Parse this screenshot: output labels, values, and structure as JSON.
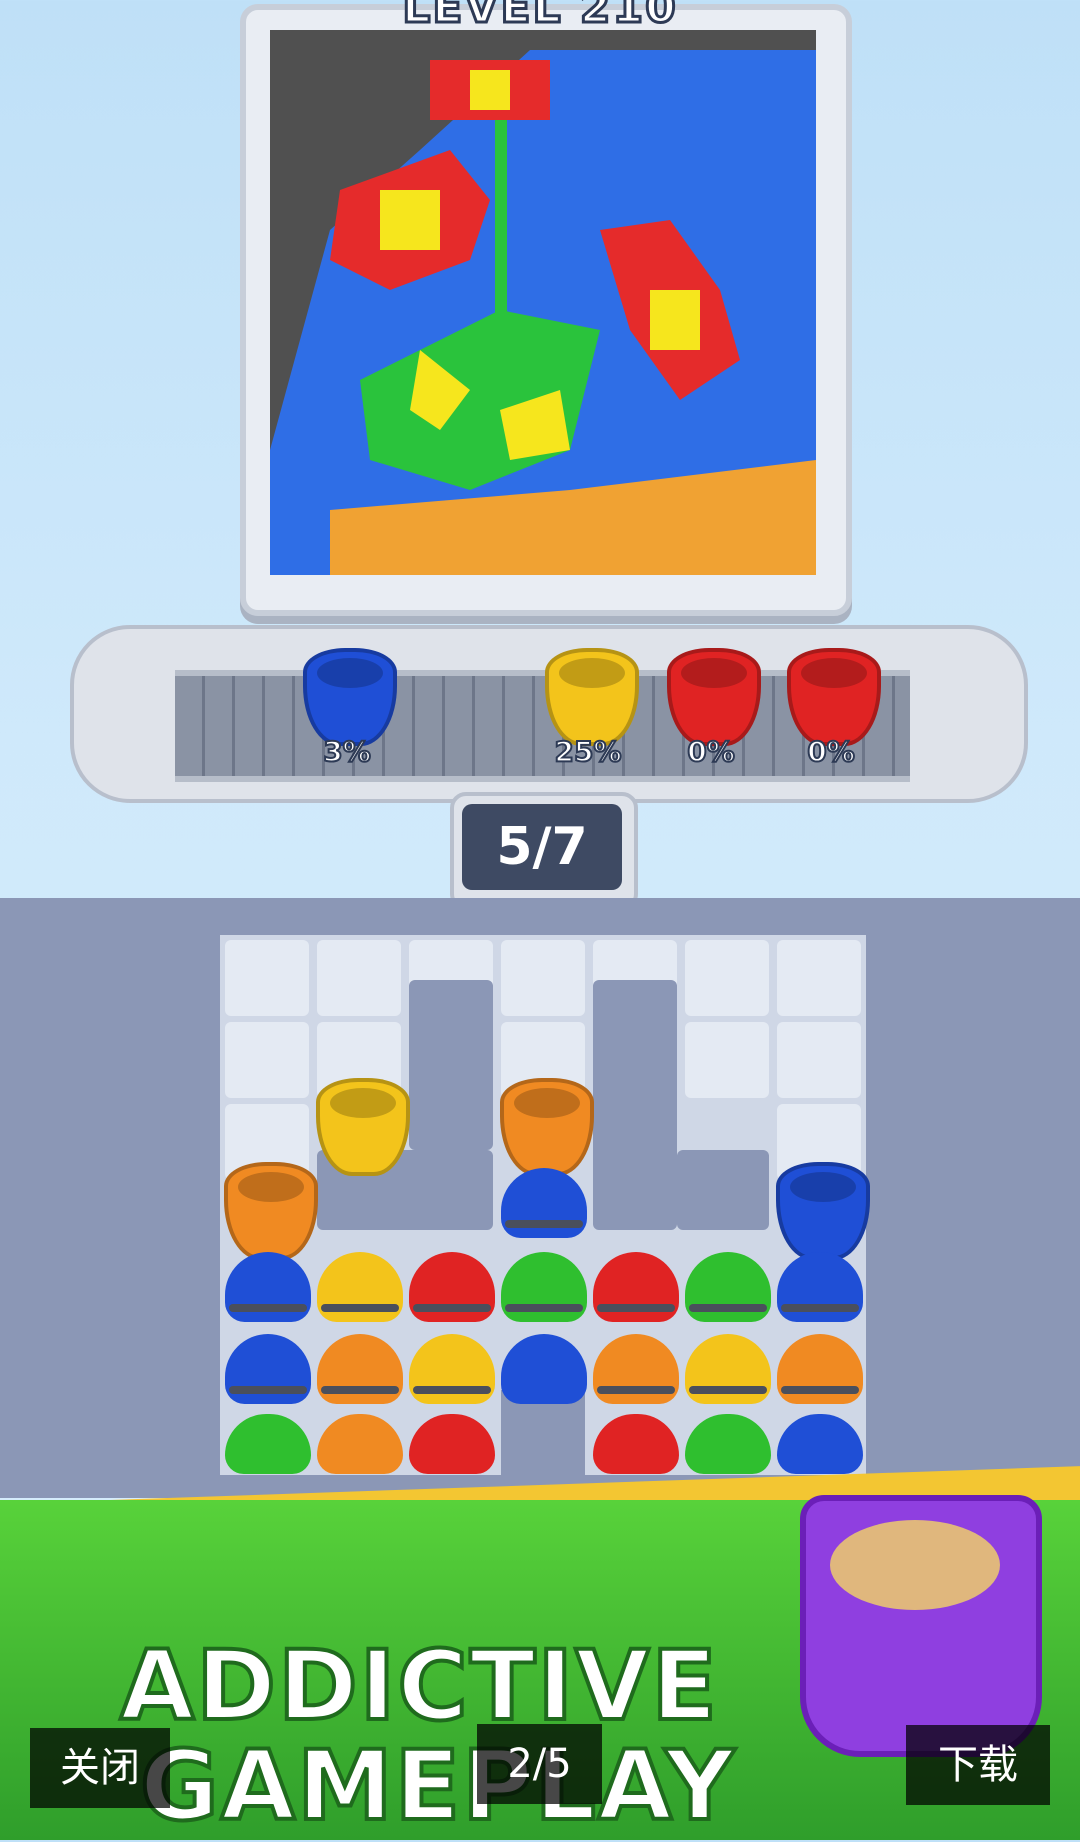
{
  "level": {
    "title": "LEVEL 210"
  },
  "conveyor": {
    "cups": [
      {
        "color": "#1f4fd6",
        "percent": "3%"
      },
      {
        "color": "#f3c41b",
        "percent": "25%"
      },
      {
        "color": "#e02323",
        "percent": "0%"
      },
      {
        "color": "#e02323",
        "percent": "0%"
      }
    ]
  },
  "progress": {
    "text": "5/7"
  },
  "banner": {
    "line1": "ADDICTIVE",
    "line2": "GAMEPLAY"
  },
  "ad_controls": {
    "close": "关闭",
    "page": "2/5",
    "download": "下载"
  },
  "colors": {
    "blue": "#1f4fd6",
    "yellow": "#f3c41b",
    "red": "#e02323",
    "green": "#2fbf2f",
    "orange": "#f08a22"
  }
}
